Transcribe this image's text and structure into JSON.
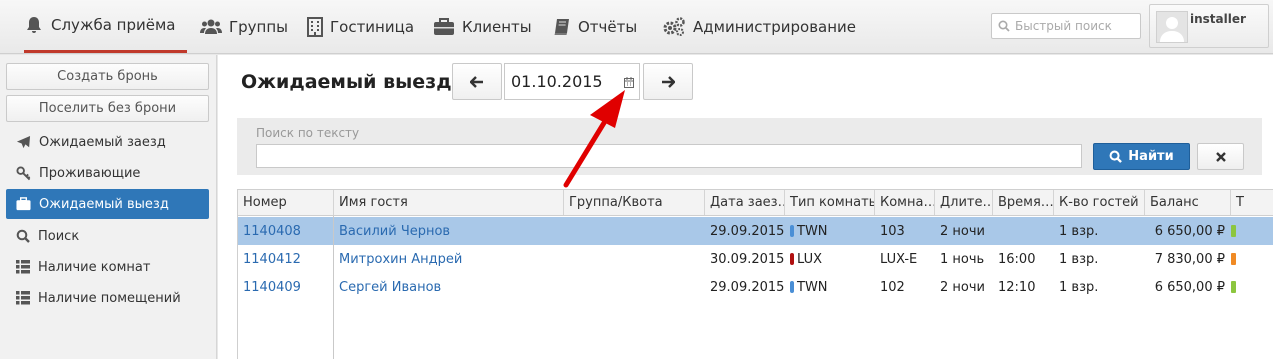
{
  "nav": {
    "items": [
      {
        "label": "Служба приёма",
        "icon": "bell-icon"
      },
      {
        "label": "Группы",
        "icon": "group-icon"
      },
      {
        "label": "Гостиница",
        "icon": "building-icon"
      },
      {
        "label": "Клиенты",
        "icon": "briefcase-icon"
      },
      {
        "label": "Отчёты",
        "icon": "book-icon"
      },
      {
        "label": "Администрирование",
        "icon": "gears-icon"
      }
    ],
    "quick_search_placeholder": "Быстрый поиск",
    "user": "installer"
  },
  "sidebar": {
    "buttons": [
      "Создать бронь",
      "Поселить без брони"
    ],
    "items": [
      {
        "label": "Ожидаемый заезд",
        "icon": "plane-icon"
      },
      {
        "label": "Проживающие",
        "icon": "key-icon"
      },
      {
        "label": "Ожидаемый выезд",
        "icon": "suitcase-icon",
        "active": true
      },
      {
        "label": "Поиск",
        "icon": "search-icon"
      },
      {
        "label": "Наличие комнат",
        "icon": "grid-icon"
      },
      {
        "label": "Наличие помещений",
        "icon": "grid-icon"
      }
    ]
  },
  "main": {
    "title": "Ожидаемый выезд",
    "date": "01.10.2015",
    "search_label": "Поиск по тексту",
    "search_value": "",
    "find_label": "Найти"
  },
  "colors": {
    "accent": "#2f77b8",
    "active_underline": "#c0392b",
    "selected_row": "#a9c8e8",
    "twn": "#4a8fd6",
    "lux": "#b01010",
    "balance_green": "#8cc63f",
    "balance_orange": "#f08a24",
    "arrow": "#e00000"
  },
  "table": {
    "columns": [
      "Номер",
      "Имя гостя",
      "Группа/Квота",
      "Дата заез…",
      "Тип комнаты",
      "Комна…",
      "Длите…",
      "Время…",
      "К-во гостей",
      "Баланс",
      "Т"
    ],
    "rows": [
      {
        "number": "1140408",
        "guest": "Василий Чернов",
        "group": "",
        "arrival": "29.09.2015",
        "room_type": "TWN",
        "room_color": "#4a8fd6",
        "room": "103",
        "duration": "2 ночи",
        "time": "",
        "guests": "1 взр.",
        "balance": "6 650,00 ₽",
        "balance_color": "#8cc63f",
        "selected": true
      },
      {
        "number": "1140412",
        "guest": "Митрохин Андрей",
        "group": "",
        "arrival": "30.09.2015",
        "room_type": "LUX",
        "room_color": "#b01010",
        "room": "LUX-E",
        "duration": "1 ночь",
        "time": "16:00",
        "guests": "1 взр.",
        "balance": "7 830,00 ₽",
        "balance_color": "#f08a24",
        "selected": false
      },
      {
        "number": "1140409",
        "guest": "Сергей Иванов",
        "group": "",
        "arrival": "29.09.2015",
        "room_type": "TWN",
        "room_color": "#4a8fd6",
        "room": "102",
        "duration": "2 ночи",
        "time": "12:10",
        "guests": "1 взр.",
        "balance": "6 650,00 ₽",
        "balance_color": "#8cc63f",
        "selected": false
      }
    ]
  }
}
